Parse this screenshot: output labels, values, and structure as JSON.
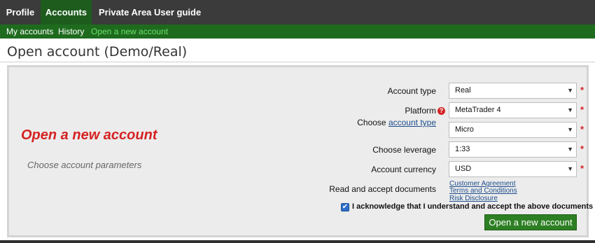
{
  "nav": {
    "tabs": [
      "Profile",
      "Accounts",
      "Private Area User guide"
    ],
    "sub": [
      "My accounts",
      "History",
      "Open a new account"
    ]
  },
  "page": {
    "title": "Open account (Demo/Real)"
  },
  "promo": {
    "title": "Open a new account",
    "subtitle": "Choose account parameters"
  },
  "form": {
    "account_type": {
      "label": "Account type",
      "value": "Real"
    },
    "platform": {
      "label": "Platform",
      "value": "MetaTrader 4"
    },
    "choose": {
      "prefix": "Choose",
      "link": "account type",
      "value": "Micro"
    },
    "leverage": {
      "label": "Choose leverage",
      "value": "1:33"
    },
    "currency": {
      "label": "Account currency",
      "value": "USD"
    },
    "docs": {
      "label": "Read and accept documents",
      "links": [
        "Customer Agreement",
        "Terms and Conditions",
        "Risk Disclosure"
      ]
    },
    "acknowledge": "I acknowledge that I understand and accept the above documents",
    "submit": "Open a new account",
    "required_mark": "*",
    "help_mark": "?"
  }
}
